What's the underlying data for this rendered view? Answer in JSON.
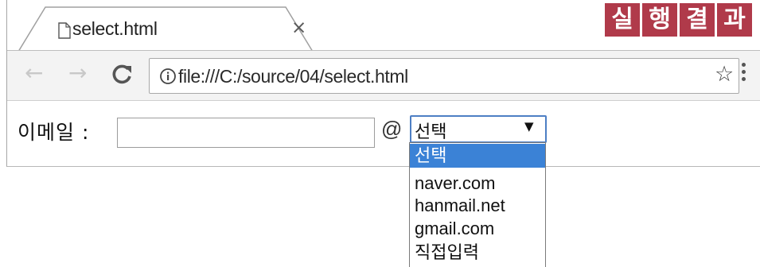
{
  "tab": {
    "title": "select.html",
    "close": "×"
  },
  "toolbar": {
    "back": "←",
    "forward": "→",
    "url": "file:///C:/source/04/select.html",
    "star": "☆"
  },
  "form": {
    "email_label": "이메일 :",
    "email_value": "",
    "at": "@",
    "select_value": "선택",
    "arrow": "▼"
  },
  "dropdown": {
    "options": [
      "선택",
      "naver.com",
      "hanmail.net",
      "gmail.com",
      "직접입력"
    ],
    "selected_index": 0
  },
  "badge": {
    "chars": [
      "실",
      "행",
      "결",
      "과"
    ]
  },
  "colors": {
    "highlight": "#3b82d6",
    "badge": "#b03a4a",
    "select_border": "#4d7fc4"
  }
}
